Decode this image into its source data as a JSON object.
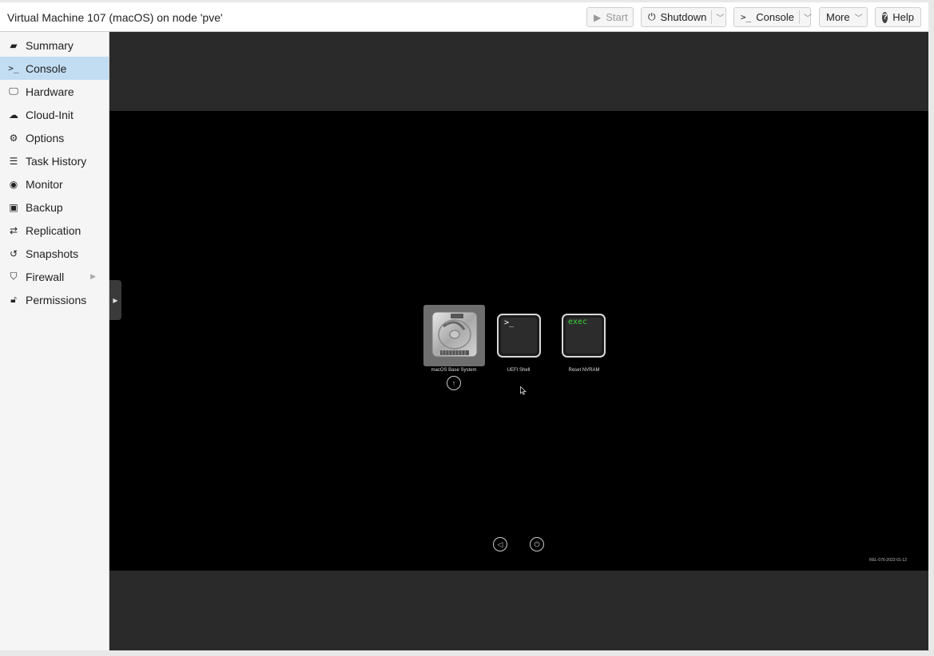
{
  "header": {
    "title": "Virtual Machine 107 (macOS) on node 'pve'",
    "buttons": {
      "start": "Start",
      "shutdown": "Shutdown",
      "console": "Console",
      "more": "More",
      "help": "Help"
    }
  },
  "sidebar": {
    "items": [
      {
        "label": "Summary",
        "icon": "book-icon"
      },
      {
        "label": "Console",
        "icon": "terminal-icon"
      },
      {
        "label": "Hardware",
        "icon": "monitor-icon"
      },
      {
        "label": "Cloud-Init",
        "icon": "cloud-icon"
      },
      {
        "label": "Options",
        "icon": "gear-icon"
      },
      {
        "label": "Task History",
        "icon": "list-icon"
      },
      {
        "label": "Monitor",
        "icon": "eye-icon"
      },
      {
        "label": "Backup",
        "icon": "floppy-icon"
      },
      {
        "label": "Replication",
        "icon": "retweet-icon"
      },
      {
        "label": "Snapshots",
        "icon": "history-icon"
      },
      {
        "label": "Firewall",
        "icon": "shield-icon"
      },
      {
        "label": "Permissions",
        "icon": "unlock-icon"
      }
    ],
    "active": "Console"
  },
  "console": {
    "boot_entries": [
      {
        "label": "macOS Base System",
        "icon": "hard-drive-icon"
      },
      {
        "label": "UEFI Shell",
        "icon": "terminal-icon",
        "glyph": ">_"
      },
      {
        "label": "Reset NVRAM",
        "icon": "terminal-icon",
        "glyph": "exec"
      }
    ],
    "version": "REL-076-2022-01-12",
    "accent_green": "#3bd43b"
  }
}
